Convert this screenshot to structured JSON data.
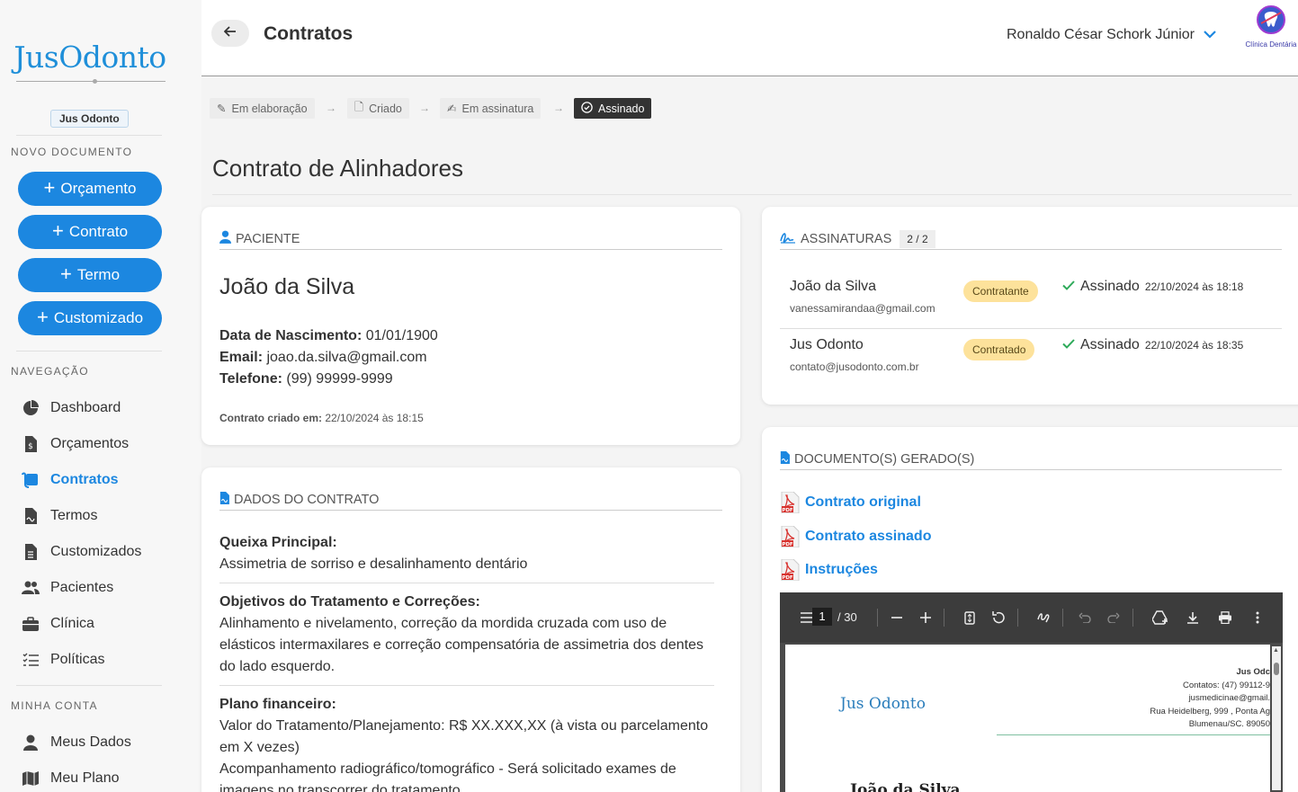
{
  "sidebar": {
    "logo": "JusOdonto",
    "org": "Jus Odonto",
    "new_title": "NOVO DOCUMENTO",
    "new_buttons": [
      "Orçamento",
      "Contrato",
      "Termo",
      "Customizado"
    ],
    "nav_title": "NAVEGAÇÃO",
    "nav_items": [
      "Dashboard",
      "Orçamentos",
      "Contratos",
      "Termos",
      "Customizados",
      "Pacientes",
      "Clínica",
      "Políticas"
    ],
    "active_item": "Contratos",
    "account_title": "MINHA CONTA",
    "account_items": [
      "Meus Dados",
      "Meu Plano"
    ]
  },
  "header": {
    "title": "Contratos",
    "user": "Ronaldo César Schork Júnior",
    "clinic_label": "Clínica Dentária"
  },
  "steps": [
    "Em elaboração",
    "Criado",
    "Em assinatura",
    "Assinado"
  ],
  "current_step": "Assinado",
  "doc_title": "Contrato de Alinhadores",
  "patient": {
    "section": "PACIENTE",
    "name": "João da Silva",
    "birth_label": "Data de Nascimento:",
    "birth": "01/01/1900",
    "email_label": "Email:",
    "email": "joao.da.silva@gmail.com",
    "phone_label": "Telefone:",
    "phone": "(99) 99999-9999",
    "created_label": "Contrato criado em:",
    "created": "22/10/2024 às 18:15"
  },
  "contract": {
    "section": "DADOS DO CONTRATO",
    "complaint_label": "Queixa Principal:",
    "complaint": "Assimetria de sorriso e desalinhamento dentário",
    "goals_label": "Objetivos do Tratamento e Correções:",
    "goals": "Alinhamento e nivelamento, correção da mordida cruzada com uso de elásticos intermaxilares e correção compensatória de assimetria dos dentes do lado esquerdo.",
    "plan_label": "Plano financeiro:",
    "plan_line1": "Valor do Tratamento/Planejamento: R$ XX.XXX,XX (à vista ou parcelamento em X vezes)",
    "plan_line2": "Acompanhamento radiográfico/tomográfico - Será solicitado exames de imagens no transcorrer do tratamento"
  },
  "signatures": {
    "section": "ASSINATURAS",
    "count": "2 / 2",
    "rows": [
      {
        "name": "João da Silva",
        "email": "vanessamirandaa@gmail.com",
        "role": "Contratante",
        "status": "Assinado",
        "date": "22/10/2024 às 18:18"
      },
      {
        "name": "Jus Odonto",
        "email": "contato@jusodonto.com.br",
        "role": "Contratado",
        "status": "Assinado",
        "date": "22/10/2024 às 18:35"
      }
    ]
  },
  "documents": {
    "section": "DOCUMENTO(S) GERADO(S)",
    "links": [
      "Contrato original",
      "Contrato assinado",
      "Instruções"
    ]
  },
  "viewer": {
    "page": "1",
    "total": "/ 30",
    "pdf_logo": "Jus Odonto",
    "pdf_org": "Jus Odc",
    "pdf_contacts": "Contatos: (47) 99112-9",
    "pdf_email": "jusmedicinae@gmail.",
    "pdf_address": "Rua Heidelberg, 999 , Ponta Ag",
    "pdf_city": "Blumenau/SC. 89050",
    "pdf_name": "João da Silva"
  }
}
